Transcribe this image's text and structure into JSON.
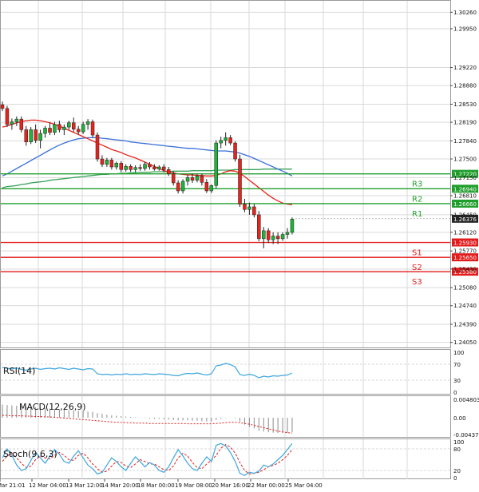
{
  "colors": {
    "grid": "#d9d9d9",
    "up_candle": "#1fb33a",
    "down_candle": "#e8231c",
    "wick": "#222222",
    "resistance": "#1f9e2b",
    "support": "#e11b1b",
    "ma_red": "#e8231c",
    "ma_blue": "#3a6fd8",
    "ma_green": "#3aa35b",
    "oscillator": "#3ea7df",
    "signal": "#e11b1b",
    "axis_text": "#111111",
    "label_box_red": "#e11b1b",
    "label_box_green": "#1f9e2b",
    "current_box": "#222222"
  },
  "chart_data": [
    {
      "type": "line",
      "panel": "price",
      "x_ticks": [
        "Mar 21:01",
        "12 Mar 04:00",
        "13 Mar 12:00",
        "14 Mar 20:00",
        "18 Mar 00:00",
        "19 Mar 08:00",
        "20 Mar 16:00",
        "22 Mar 00:00",
        "25 Mar 04:00"
      ],
      "y_ticks": [
        "1.30260",
        "1.29950",
        "1.29220",
        "1.28880",
        "1.28530",
        "1.28190",
        "1.27840",
        "1.27500",
        "1.27150",
        "1.26810",
        "1.26450",
        "1.26120",
        "1.25770",
        "1.25430",
        "1.25080",
        "1.24740",
        "1.24390",
        "1.24050"
      ],
      "y_range": [
        1.24,
        1.304
      ],
      "levels": [
        {
          "name": "R3",
          "value": 1.2722,
          "tag": "1.27220",
          "role": "resistance"
        },
        {
          "name": "R2",
          "value": 1.2694,
          "tag": "1.26940",
          "role": "resistance"
        },
        {
          "name": "R1",
          "value": 1.2666,
          "tag": "1.26660",
          "role": "resistance"
        },
        {
          "name": "S1",
          "value": 1.2593,
          "tag": "1.25930",
          "role": "support"
        },
        {
          "name": "S2",
          "value": 1.2565,
          "tag": "1.25650",
          "role": "support"
        },
        {
          "name": "S3",
          "value": 1.2538,
          "tag": "1.25380",
          "role": "support"
        }
      ],
      "current_price": {
        "value": 1.26376,
        "tag": "1.26376"
      },
      "candles": [
        [
          1.2852,
          1.2858,
          1.284,
          1.2845
        ],
        [
          1.2845,
          1.285,
          1.281,
          1.2815
        ],
        [
          1.2815,
          1.2826,
          1.2805,
          1.282
        ],
        [
          1.282,
          1.283,
          1.2812,
          1.2825
        ],
        [
          1.2825,
          1.283,
          1.28,
          1.2805
        ],
        [
          1.2805,
          1.2812,
          1.2775,
          1.2782
        ],
        [
          1.2782,
          1.281,
          1.2778,
          1.2805
        ],
        [
          1.2805,
          1.2815,
          1.278,
          1.2785
        ],
        [
          1.2785,
          1.2805,
          1.277,
          1.2798
        ],
        [
          1.2798,
          1.2812,
          1.279,
          1.2808
        ],
        [
          1.2808,
          1.2818,
          1.2795,
          1.28
        ],
        [
          1.28,
          1.282,
          1.2795,
          1.2815
        ],
        [
          1.2815,
          1.2822,
          1.28,
          1.2805
        ],
        [
          1.2805,
          1.2815,
          1.2795,
          1.281
        ],
        [
          1.281,
          1.2822,
          1.2805,
          1.2818
        ],
        [
          1.2818,
          1.2828,
          1.28,
          1.2806
        ],
        [
          1.2806,
          1.2812,
          1.2796,
          1.2801
        ],
        [
          1.2801,
          1.282,
          1.2797,
          1.2815
        ],
        [
          1.2815,
          1.2825,
          1.2805,
          1.282
        ],
        [
          1.282,
          1.2824,
          1.279,
          1.2795
        ],
        [
          1.2795,
          1.28,
          1.2745,
          1.275
        ],
        [
          1.275,
          1.2757,
          1.2735,
          1.274
        ],
        [
          1.274,
          1.2752,
          1.2735,
          1.2748
        ],
        [
          1.2748,
          1.2752,
          1.273,
          1.2735
        ],
        [
          1.2735,
          1.2745,
          1.273,
          1.2742
        ],
        [
          1.2742,
          1.2746,
          1.2725,
          1.273
        ],
        [
          1.273,
          1.274,
          1.2726,
          1.2736
        ],
        [
          1.2736,
          1.274,
          1.2726,
          1.273
        ],
        [
          1.273,
          1.2738,
          1.2725,
          1.2734
        ],
        [
          1.2734,
          1.274,
          1.2728,
          1.2732
        ],
        [
          1.2732,
          1.2745,
          1.2728,
          1.274
        ],
        [
          1.274,
          1.2744,
          1.273,
          1.2735
        ],
        [
          1.2735,
          1.274,
          1.2728,
          1.2731
        ],
        [
          1.2731,
          1.2738,
          1.2728,
          1.2735
        ],
        [
          1.2735,
          1.274,
          1.2725,
          1.273
        ],
        [
          1.273,
          1.2735,
          1.2718,
          1.2722
        ],
        [
          1.2722,
          1.2727,
          1.27,
          1.2705
        ],
        [
          1.2705,
          1.271,
          1.2685,
          1.269
        ],
        [
          1.269,
          1.2712,
          1.2685,
          1.2708
        ],
        [
          1.2708,
          1.272,
          1.27,
          1.2715
        ],
        [
          1.2715,
          1.2722,
          1.2705,
          1.271
        ],
        [
          1.271,
          1.2722,
          1.2706,
          1.2718
        ],
        [
          1.2718,
          1.2722,
          1.27,
          1.2706
        ],
        [
          1.2706,
          1.2712,
          1.2686,
          1.269
        ],
        [
          1.269,
          1.2702,
          1.2686,
          1.27
        ],
        [
          1.27,
          1.2785,
          1.2695,
          1.278
        ],
        [
          1.278,
          1.2792,
          1.277,
          1.2785
        ],
        [
          1.2785,
          1.28,
          1.2775,
          1.279
        ],
        [
          1.279,
          1.2795,
          1.2776,
          1.278
        ],
        [
          1.278,
          1.2783,
          1.2745,
          1.275
        ],
        [
          1.275,
          1.2758,
          1.266,
          1.2665
        ],
        [
          1.2665,
          1.2675,
          1.265,
          1.2655
        ],
        [
          1.2655,
          1.2668,
          1.2645,
          1.266
        ],
        [
          1.266,
          1.2665,
          1.264,
          1.2645
        ],
        [
          1.2645,
          1.2652,
          1.2595,
          1.26
        ],
        [
          1.26,
          1.2622,
          1.2582,
          1.2615
        ],
        [
          1.2615,
          1.262,
          1.2592,
          1.2598
        ],
        [
          1.2598,
          1.2612,
          1.259,
          1.2605
        ],
        [
          1.2605,
          1.2612,
          1.259,
          1.26
        ],
        [
          1.26,
          1.2612,
          1.2596,
          1.2608
        ],
        [
          1.2608,
          1.262,
          1.26,
          1.2612
        ],
        [
          1.2612,
          1.264,
          1.2608,
          1.2637
        ]
      ],
      "ma_red": [
        1.281,
        1.2812,
        1.2815,
        1.2818,
        1.282,
        1.2822,
        1.2823,
        1.2823,
        1.2822,
        1.282,
        1.2818,
        1.2815,
        1.2812,
        1.2808,
        1.2804,
        1.28,
        1.2796,
        1.2792,
        1.2788,
        1.2784,
        1.278,
        1.2776,
        1.2772,
        1.2768,
        1.2765,
        1.2762,
        1.2758,
        1.2755,
        1.2752,
        1.2748,
        1.2744,
        1.274,
        1.2736,
        1.2732,
        1.2728,
        1.2726,
        1.2724,
        1.2722,
        1.2721,
        1.272,
        1.272,
        1.2719,
        1.2719,
        1.2718,
        1.2718,
        1.2719,
        1.2722,
        1.2726,
        1.2728,
        1.2727,
        1.2723,
        1.2717,
        1.271,
        1.2703,
        1.2696,
        1.2689,
        1.2682,
        1.2676,
        1.2671,
        1.2667,
        1.2665,
        1.2664
      ],
      "ma_blue": [
        1.2718,
        1.2722,
        1.2727,
        1.2732,
        1.2737,
        1.2742,
        1.2747,
        1.2752,
        1.2757,
        1.2762,
        1.2767,
        1.2772,
        1.2776,
        1.278,
        1.2783,
        1.2786,
        1.2788,
        1.2789,
        1.279,
        1.279,
        1.279,
        1.2789,
        1.2788,
        1.2787,
        1.2786,
        1.2785,
        1.2784,
        1.2782,
        1.2781,
        1.278,
        1.2779,
        1.2778,
        1.2777,
        1.2776,
        1.2775,
        1.2774,
        1.2773,
        1.2772,
        1.2771,
        1.277,
        1.277,
        1.2769,
        1.2768,
        1.2767,
        1.2766,
        1.2765,
        1.2765,
        1.2765,
        1.2764,
        1.2763,
        1.2761,
        1.2758,
        1.2755,
        1.2751,
        1.2747,
        1.2743,
        1.2739,
        1.2735,
        1.2731,
        1.2727,
        1.2723,
        1.2718
      ],
      "ma_green": [
        1.2696,
        1.2698,
        1.2699,
        1.27,
        1.2702,
        1.2703,
        1.2705,
        1.2706,
        1.2707,
        1.2708,
        1.271,
        1.2711,
        1.2712,
        1.2713,
        1.2714,
        1.2715,
        1.2716,
        1.2717,
        1.2718,
        1.2719,
        1.272,
        1.2721,
        1.2721,
        1.2722,
        1.2722,
        1.2723,
        1.2723,
        1.2724,
        1.2724,
        1.2725,
        1.2725,
        1.2725,
        1.2726,
        1.2726,
        1.2726,
        1.2726,
        1.2727,
        1.2727,
        1.2727,
        1.2727,
        1.2728,
        1.2728,
        1.2728,
        1.2728,
        1.2728,
        1.2729,
        1.2729,
        1.2729,
        1.2729,
        1.273,
        1.273,
        1.273,
        1.273,
        1.273,
        1.273,
        1.2731,
        1.2731,
        1.2731,
        1.2731,
        1.2731,
        1.2731,
        1.2731
      ]
    },
    {
      "type": "line",
      "panel": "rsi",
      "label": "RSI(14)",
      "y_ticks": [
        "100",
        "70",
        "30",
        "0"
      ],
      "y_range": [
        0,
        100
      ],
      "values": [
        62,
        60,
        58,
        61,
        57,
        55,
        58,
        60,
        57,
        59,
        60,
        58,
        61,
        59,
        57,
        60,
        58,
        56,
        59,
        58,
        46,
        44,
        45,
        43,
        45,
        44,
        46,
        44,
        45,
        44,
        46,
        45,
        44,
        46,
        45,
        44,
        42,
        41,
        45,
        47,
        46,
        48,
        45,
        43,
        46,
        66,
        68,
        72,
        69,
        63,
        44,
        42,
        45,
        42,
        36,
        40,
        38,
        41,
        40,
        42,
        43,
        48
      ]
    },
    {
      "type": "bar",
      "panel": "macd",
      "label": "MACD(12,26,9)",
      "y_ticks": [
        "0.004803",
        "0.00",
        "-0.004377"
      ],
      "y_range": [
        -0.0048,
        0.0052
      ],
      "histogram": [
        0.0034,
        0.0033,
        0.0032,
        0.0031,
        0.003,
        0.0029,
        0.0028,
        0.0027,
        0.0026,
        0.0025,
        0.0024,
        0.0023,
        0.0022,
        0.0021,
        0.002,
        0.0019,
        0.0018,
        0.0017,
        0.0016,
        0.0015,
        0.0012,
        0.001,
        0.0008,
        0.0006,
        0.0005,
        0.0004,
        0.0003,
        0.0002,
        0.0001,
        0.0,
        -0.0001,
        -0.0002,
        -0.0003,
        -0.0003,
        -0.0004,
        -0.0005,
        -0.0006,
        -0.0007,
        -0.0007,
        -0.0007,
        -0.0008,
        -0.0008,
        -0.0009,
        -0.001,
        -0.001,
        -0.0006,
        -0.0003,
        -0.0001,
        0.0,
        -0.0002,
        -0.001,
        -0.0018,
        -0.0024,
        -0.0028,
        -0.0034,
        -0.0036,
        -0.0038,
        -0.0039,
        -0.004,
        -0.004,
        -0.004,
        -0.0038
      ],
      "signal": [
        0.0006,
        0.0006,
        0.0005,
        0.0005,
        0.0005,
        0.0004,
        0.0004,
        0.0003,
        0.0003,
        0.0002,
        0.0002,
        0.0001,
        0.0,
        -0.0001,
        -0.0002,
        -0.0003,
        -0.0004,
        -0.0005,
        -0.0006,
        -0.0007,
        -0.0008,
        -0.0009,
        -0.001,
        -0.0011,
        -0.0012,
        -0.0012,
        -0.0013,
        -0.0013,
        -0.0014,
        -0.0014,
        -0.0014,
        -0.0015,
        -0.0015,
        -0.0015,
        -0.0015,
        -0.0015,
        -0.0015,
        -0.0015,
        -0.0015,
        -0.0016,
        -0.0016,
        -0.0016,
        -0.0016,
        -0.0016,
        -0.0016,
        -0.0015,
        -0.0014,
        -0.0013,
        -0.0012,
        -0.0012,
        -0.0013,
        -0.0015,
        -0.0017,
        -0.002,
        -0.0023,
        -0.0026,
        -0.0029,
        -0.0032,
        -0.0035,
        -0.0037,
        -0.0039,
        -0.004
      ]
    },
    {
      "type": "line",
      "panel": "stoch",
      "label": "Stoch(9,6,3)",
      "y_ticks": [
        "100",
        "80",
        "20",
        "0"
      ],
      "y_range": [
        0,
        100
      ],
      "k": [
        55,
        80,
        62,
        35,
        20,
        25,
        48,
        70,
        55,
        40,
        60,
        78,
        65,
        45,
        40,
        60,
        75,
        55,
        35,
        25,
        10,
        15,
        35,
        55,
        45,
        30,
        20,
        40,
        58,
        45,
        30,
        42,
        35,
        20,
        15,
        30,
        55,
        78,
        60,
        40,
        25,
        20,
        40,
        58,
        45,
        90,
        95,
        88,
        70,
        45,
        12,
        6,
        15,
        12,
        18,
        35,
        30,
        38,
        50,
        62,
        78,
        95
      ],
      "d": [
        45,
        60,
        68,
        55,
        40,
        28,
        32,
        50,
        60,
        55,
        52,
        62,
        70,
        62,
        50,
        48,
        62,
        68,
        55,
        38,
        25,
        15,
        18,
        32,
        45,
        42,
        32,
        28,
        38,
        50,
        45,
        38,
        38,
        30,
        22,
        20,
        32,
        55,
        68,
        60,
        42,
        28,
        25,
        38,
        48,
        62,
        82,
        92,
        85,
        68,
        42,
        20,
        10,
        12,
        15,
        22,
        30,
        34,
        40,
        50,
        62,
        78
      ]
    }
  ]
}
